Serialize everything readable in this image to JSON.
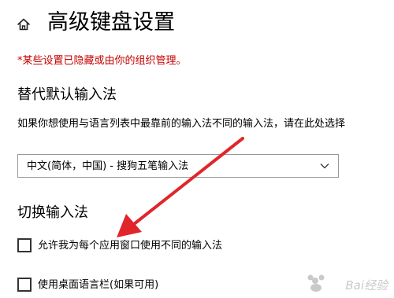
{
  "header": {
    "title": "高级键盘设置",
    "home_icon": "home-icon"
  },
  "managed_notice": "*某些设置已隐藏或由你的组织管理。",
  "default_input": {
    "heading": "替代默认输入法",
    "description": "如果你想使用与语言列表中最靠前的输入法不同的输入法，请在此处选择",
    "selected_value": "中文(简体，中国) - 搜狗五笔输入法"
  },
  "switch_input": {
    "heading": "切换输入法",
    "checkboxes": [
      {
        "label": "允许我为每个应用窗口使用不同的输入法",
        "checked": false
      },
      {
        "label": "使用桌面语言栏(如果可用)",
        "checked": false
      }
    ]
  },
  "annotation": {
    "arrow_color": "#e0262b"
  },
  "watermark": {
    "text": "Bai经验",
    "logo": "baidu-jingyan-logo"
  },
  "colors": {
    "notice": "#c50000",
    "text": "#000000",
    "border": "#999999"
  }
}
